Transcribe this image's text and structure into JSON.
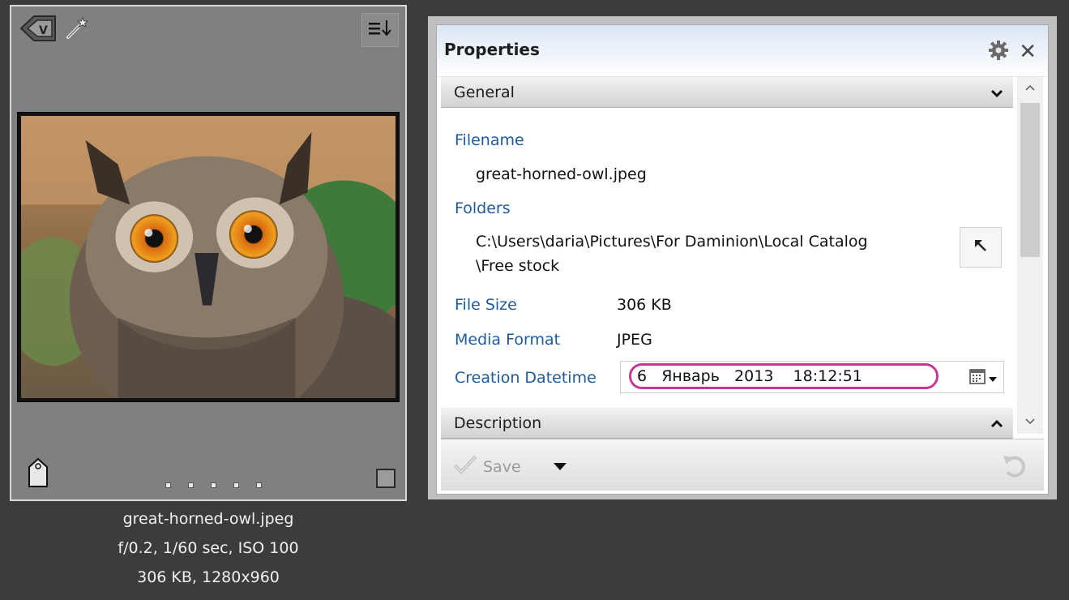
{
  "thumbnail": {
    "filename": "great-horned-owl.jpeg",
    "exif": "f/0.2, 1/60 sec, ISO 100",
    "size_dims": "306 KB, 1280x960",
    "icons": [
      "daminion-logo-icon",
      "magic-wand-icon",
      "sort-order-icon",
      "tag-icon",
      "checkbox-icon"
    ]
  },
  "panel": {
    "title": "Properties",
    "general_section": "General",
    "description_section": "Description",
    "fields": {
      "filename_label": "Filename",
      "filename_value": "great-horned-owl.jpeg",
      "folders_label": "Folders",
      "folders_value_line1": "C:\\Users\\daria\\Pictures\\For Daminion\\Local Catalog",
      "folders_value_line2": "\\Free stock",
      "filesize_label": "File Size",
      "filesize_value": "306 KB",
      "mediaformat_label": "Media Format",
      "mediaformat_value": "JPEG",
      "creation_label": "Creation Datetime",
      "creation_value": "6   Январь   2013    18:12:51"
    },
    "save_label": "Save"
  },
  "colors": {
    "label_blue": "#1e5a9c",
    "highlight_magenta": "#c33a96"
  }
}
